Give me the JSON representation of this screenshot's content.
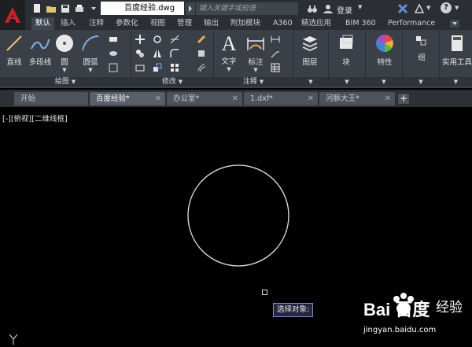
{
  "app": {
    "doc_title": "百度经验.dwg",
    "search_placeholder": "键入关键字或短语",
    "login_label": "登录",
    "help_label": "?"
  },
  "ribbon_tabs": [
    "默认",
    "插入",
    "注释",
    "参数化",
    "视图",
    "管理",
    "输出",
    "附加模块",
    "A360",
    "精选应用",
    "BIM 360",
    "Performance"
  ],
  "ribbon_active_tab": "默认",
  "draw_panel": {
    "title": "绘图",
    "buttons": [
      "直线",
      "多段线",
      "圆",
      "圆弧"
    ]
  },
  "modify_panel": {
    "title": "修改"
  },
  "annotation_panel": {
    "title": "注释",
    "buttons": [
      "文字",
      "标注"
    ]
  },
  "layers_panel": {
    "label": "图层"
  },
  "block_panel": {
    "label": "块"
  },
  "properties_panel": {
    "label": "特性"
  },
  "group_panel": {
    "label": "组"
  },
  "utilities_panel": {
    "label": "实用工具"
  },
  "file_tabs": [
    {
      "label": "开始",
      "active": false,
      "closable": false
    },
    {
      "label": "百度经验*",
      "active": true,
      "closable": true
    },
    {
      "label": "办公室*",
      "active": false,
      "closable": true
    },
    {
      "label": "1.dxf*",
      "active": false,
      "closable": true
    },
    {
      "label": "河豚大王*",
      "active": false,
      "closable": true
    }
  ],
  "viewport_label": "[-][俯视][二维线框]",
  "command_tooltip": "选择对象:",
  "watermark": {
    "brand": "Bai 百度",
    "subtitle": "经验",
    "url": "jingyan.baidu.com"
  },
  "ucs_label": "Y",
  "colors": {
    "background": "#000000",
    "ribbon": "#3b4048",
    "accent_red": "#c4262e"
  }
}
